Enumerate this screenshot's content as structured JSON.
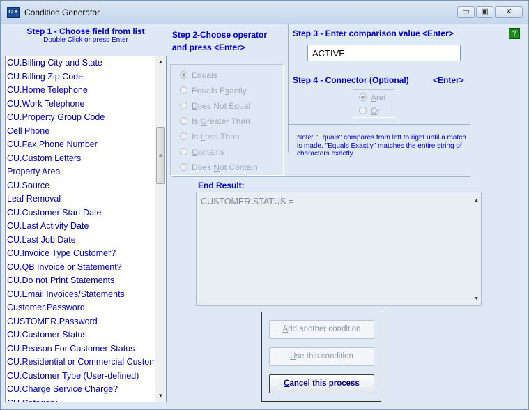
{
  "window": {
    "title": "Condition Generator",
    "icon_name": "app-icon",
    "icon_text": "CLK",
    "controls": {
      "minimize": "▭",
      "maximize": "▣",
      "close": "✕"
    }
  },
  "step1": {
    "title": "Step 1 - Choose field from list",
    "subtitle": "Double Click or press Enter",
    "fields": [
      "CU.Billing City and State",
      "CU.Billing Zip Code",
      "CU.Home Telephone",
      "CU.Work Telephone",
      "CU.Property Group Code",
      "Cell Phone",
      "CU.Fax Phone Number",
      "CU.Custom Letters",
      "Property Area",
      "CU.Source",
      "Leaf Removal",
      "CU.Customer Start Date",
      "CU.Last Activity Date",
      "CU.Last Job Date",
      "CU.Invoice Type Customer?",
      "CU.QB Invoice or Statement?",
      "CU.Do not Print Statements",
      "CU.Email Invoices/Statements",
      "Customer.Password",
      "CUSTOMER.Password",
      "CU.Customer Status",
      "CU.Reason For Customer Status",
      "CU.Residential or Commercial Customer",
      "CU.Customer Type (User-defined)",
      "CU.Charge Service Charge?",
      "CU.Category"
    ]
  },
  "step2": {
    "title_line1": "Step 2-Choose operator",
    "title_line2": "and press <Enter>",
    "operators": [
      {
        "pre": "",
        "key": "E",
        "post": "quals",
        "selected": true
      },
      {
        "pre": "Equals E",
        "key": "x",
        "post": "actly",
        "selected": false
      },
      {
        "pre": "",
        "key": "D",
        "post": "oes Not Equal",
        "selected": false
      },
      {
        "pre": "Is ",
        "key": "G",
        "post": "reater Than",
        "selected": false
      },
      {
        "pre": "Is ",
        "key": "L",
        "post": "ess Than",
        "selected": false
      },
      {
        "pre": "",
        "key": "C",
        "post": "ontains",
        "selected": false
      },
      {
        "pre": "Does ",
        "key": "N",
        "post": "ot Contain",
        "selected": false
      }
    ]
  },
  "step3": {
    "title": "Step 3 - Enter comparison value <Enter>",
    "value": "ACTIVE",
    "help_label": "?"
  },
  "step4": {
    "title": "Step 4 - Connector  (Optional)",
    "enter_hint": "<Enter>",
    "connectors": [
      {
        "key": "A",
        "post": "nd",
        "selected": true
      },
      {
        "key": "O",
        "post": "r",
        "selected": false
      }
    ]
  },
  "note": "Note: \"Equals\" compares from left to right until a match is made. \"Equals Exactly\" matches the entire string of characters exactly.",
  "end_result": {
    "title": "End Result:",
    "text": "CUSTOMER.STATUS ="
  },
  "buttons": {
    "add_pre": "",
    "add_key": "A",
    "add_post": "dd another condition",
    "use_pre": "",
    "use_key": "U",
    "use_post": "se this condition",
    "cancel_pre": "",
    "cancel_key": "C",
    "cancel_post": "ancel this process"
  },
  "colors": {
    "accent": "#0000c8",
    "list_text": "#0000aa",
    "disabled_text": "#a0a8b4",
    "help_button": "#1c8a1c"
  }
}
